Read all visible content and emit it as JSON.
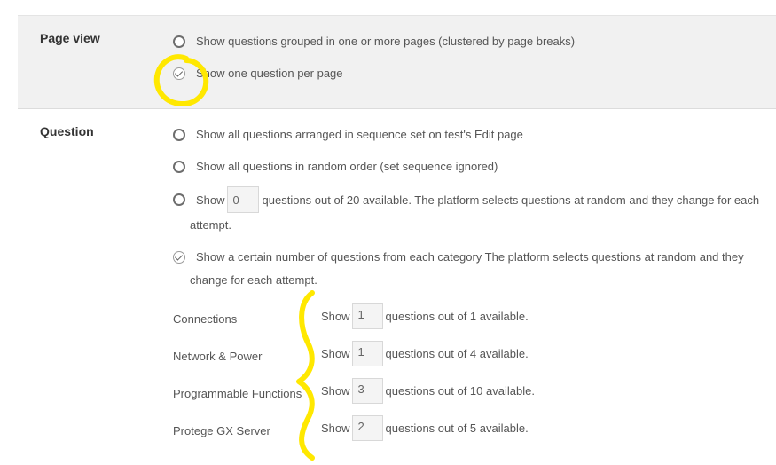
{
  "page_view": {
    "title": "Page view",
    "options": [
      "Show questions grouped in one or more pages (clustered by page breaks)",
      "Show one question per page"
    ]
  },
  "question": {
    "title": "Question",
    "opt1": "Show all questions arranged in sequence set on test's Edit page",
    "opt2": "Show all questions in random order (set sequence ignored)",
    "opt3_prefix": "Show",
    "opt3_value": "0",
    "opt3_suffix": "questions out of 20 available. The platform selects questions at random and they change for each",
    "opt3_wrap": "attempt.",
    "opt4_line1": "Show a certain number of questions from each category The platform selects questions at random and they",
    "opt4_line2": "change for each attempt."
  },
  "categories": [
    {
      "name": "Connections",
      "show": "Show",
      "value": "1",
      "suffix": "questions out of 1 available."
    },
    {
      "name": "Network & Power",
      "show": "Show",
      "value": "1",
      "suffix": "questions out of 4 available."
    },
    {
      "name": "Programmable Functions",
      "show": "Show",
      "value": "3",
      "suffix": "questions out of 10 available."
    },
    {
      "name": "Protege GX Server",
      "show": "Show",
      "value": "2",
      "suffix": "questions out of 5 available."
    }
  ],
  "colors": {
    "annotation": "#ffe800",
    "panel": "#f1f1f1"
  }
}
